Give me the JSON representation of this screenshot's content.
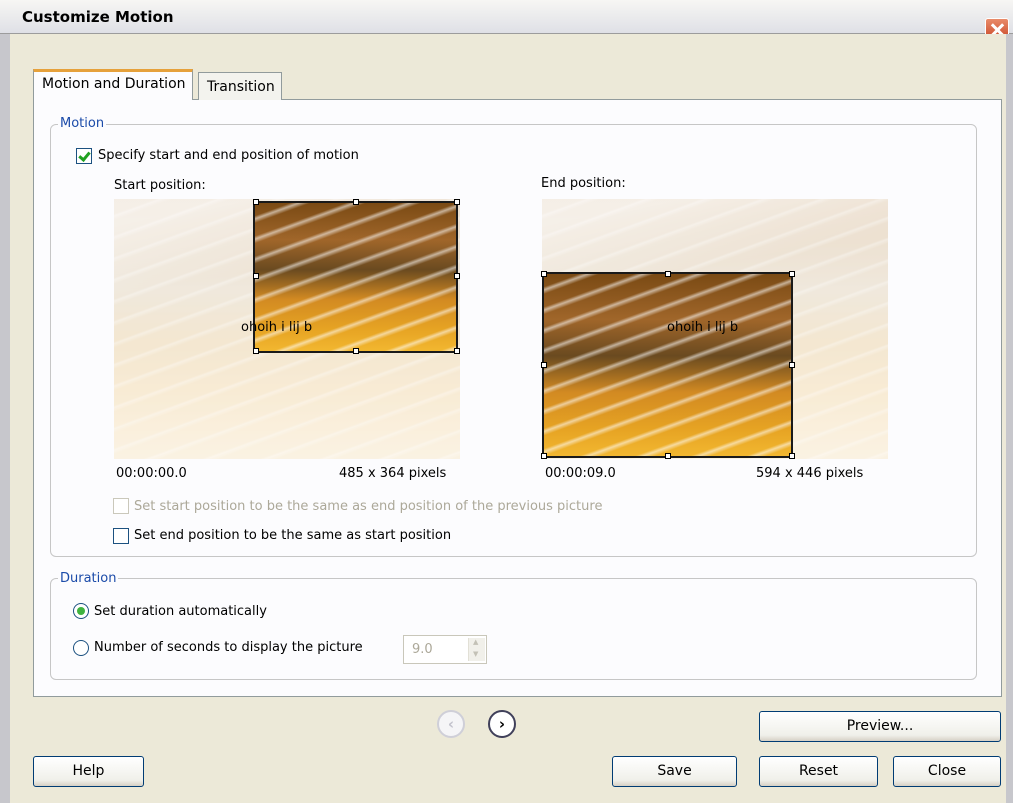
{
  "window": {
    "title": "Customize Motion"
  },
  "tabs": [
    {
      "label": "Motion and Duration",
      "active": true
    },
    {
      "label": "Transition",
      "active": false
    }
  ],
  "motion": {
    "group_title": "Motion",
    "specify_label": "Specify start and end position of motion",
    "specify_checked": true,
    "start": {
      "label": "Start position:",
      "time": "00:00:00.0",
      "size": "485 x 364 pixels",
      "frame_text": "ohoih i lij b"
    },
    "end": {
      "label": "End position:",
      "time": "00:00:09.0",
      "size": "594 x 446 pixels",
      "frame_text": "ohoih i lij b"
    },
    "same_start_label": "Set start position to be the same as end position of the previous picture",
    "same_start_enabled": false,
    "same_end_label": "Set end position to be the same as start position",
    "same_end_checked": false
  },
  "duration": {
    "group_title": "Duration",
    "auto_label": "Set duration automatically",
    "auto_selected": true,
    "seconds_label": "Number of seconds to display the picture",
    "seconds_value": "9.0"
  },
  "nav": {
    "prev_glyph": "‹",
    "next_glyph": "›"
  },
  "buttons": {
    "preview": "Preview...",
    "help": "Help",
    "save": "Save",
    "reset": "Reset",
    "close": "Close"
  },
  "colors": {
    "group_title": "#1b4ba9",
    "active_tab_accent": "#e6a13b",
    "close_button": "#c74424"
  }
}
